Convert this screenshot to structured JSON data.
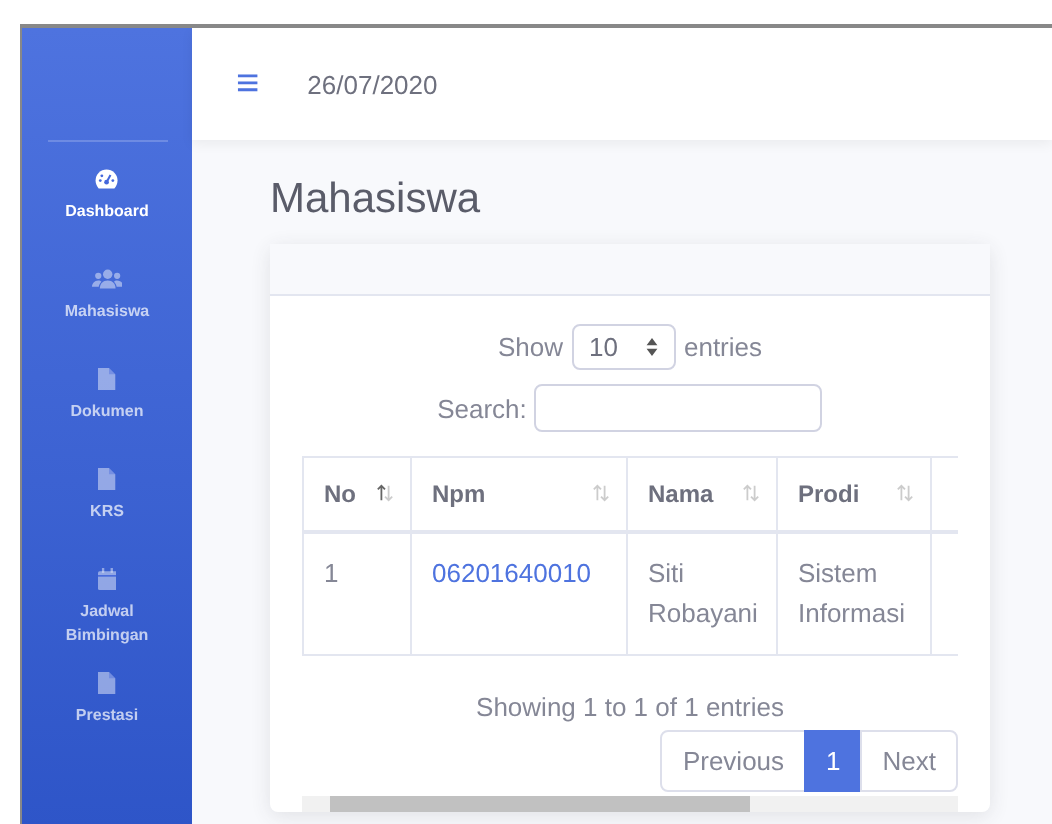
{
  "sidebar": {
    "items": [
      {
        "label": "Dashboard",
        "selected": true
      },
      {
        "label": "Mahasiswa",
        "selected": false
      },
      {
        "label": "Dokumen",
        "selected": false
      },
      {
        "label": "KRS",
        "selected": false
      },
      {
        "label": "Jadwal Bimbingan",
        "selected": false
      },
      {
        "label": "Prestasi",
        "selected": false
      }
    ]
  },
  "topbar": {
    "menu_icon": "≡",
    "date": "26/07/2020"
  },
  "page_title": "Mahasiswa",
  "table_controls": {
    "show_label": "Show",
    "page_size": "10",
    "entries_label": "entries",
    "search_label": "Search:"
  },
  "table": {
    "columns": [
      {
        "label": "No",
        "sorted": true
      },
      {
        "label": "Npm",
        "sorted": false
      },
      {
        "label": "Nama",
        "sorted": false
      },
      {
        "label": "Prodi",
        "sorted": false
      }
    ],
    "rows": [
      {
        "cells": [
          {
            "text": "1",
            "kind": "plain"
          },
          {
            "text": "06201640010",
            "kind": "link"
          },
          {
            "text": "Siti Robayani",
            "kind": "plain"
          },
          {
            "text": "Sistem Informasi",
            "kind": "plain"
          }
        ]
      }
    ]
  },
  "info": "Showing 1 to 1 of 1 entries",
  "pagination": [
    {
      "label": "Previous",
      "selected": false
    },
    {
      "label": "1",
      "selected": true
    },
    {
      "label": "Next",
      "selected": false
    }
  ]
}
